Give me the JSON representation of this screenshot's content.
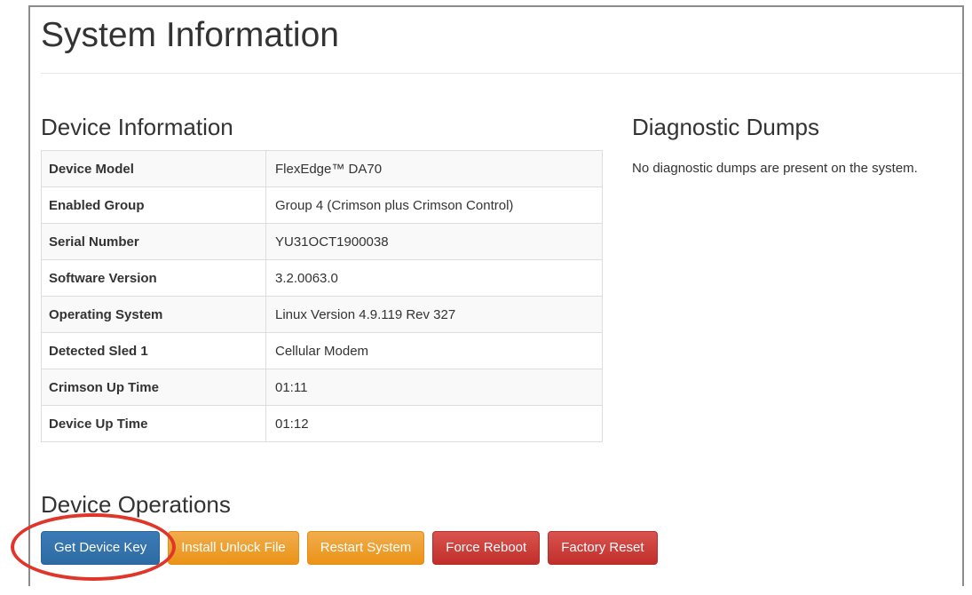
{
  "page": {
    "title": "System Information"
  },
  "device_info": {
    "heading": "Device Information",
    "rows": [
      {
        "key": "Device Model",
        "value": "FlexEdge™ DA70"
      },
      {
        "key": "Enabled Group",
        "value": "Group 4 (Crimson plus Crimson Control)"
      },
      {
        "key": "Serial Number",
        "value": "YU31OCT1900038"
      },
      {
        "key": "Software Version",
        "value": "3.2.0063.0"
      },
      {
        "key": "Operating System",
        "value": "Linux Version 4.9.119 Rev 327"
      },
      {
        "key": "Detected Sled 1",
        "value": "Cellular Modem"
      },
      {
        "key": "Crimson Up Time",
        "value": "01:11"
      },
      {
        "key": "Device Up Time",
        "value": "01:12"
      }
    ]
  },
  "diagnostic_dumps": {
    "heading": "Diagnostic Dumps",
    "message": "No diagnostic dumps are present on the system."
  },
  "device_operations": {
    "heading": "Device Operations",
    "buttons": [
      {
        "label": "Get Device Key"
      },
      {
        "label": "Install Unlock File"
      },
      {
        "label": "Restart System"
      },
      {
        "label": "Force Reboot"
      },
      {
        "label": "Factory Reset"
      }
    ]
  },
  "colors": {
    "highlight_ring": "#e0362a",
    "primary": "#337ab7",
    "warning": "#f0ad4e",
    "danger": "#d9534f"
  }
}
